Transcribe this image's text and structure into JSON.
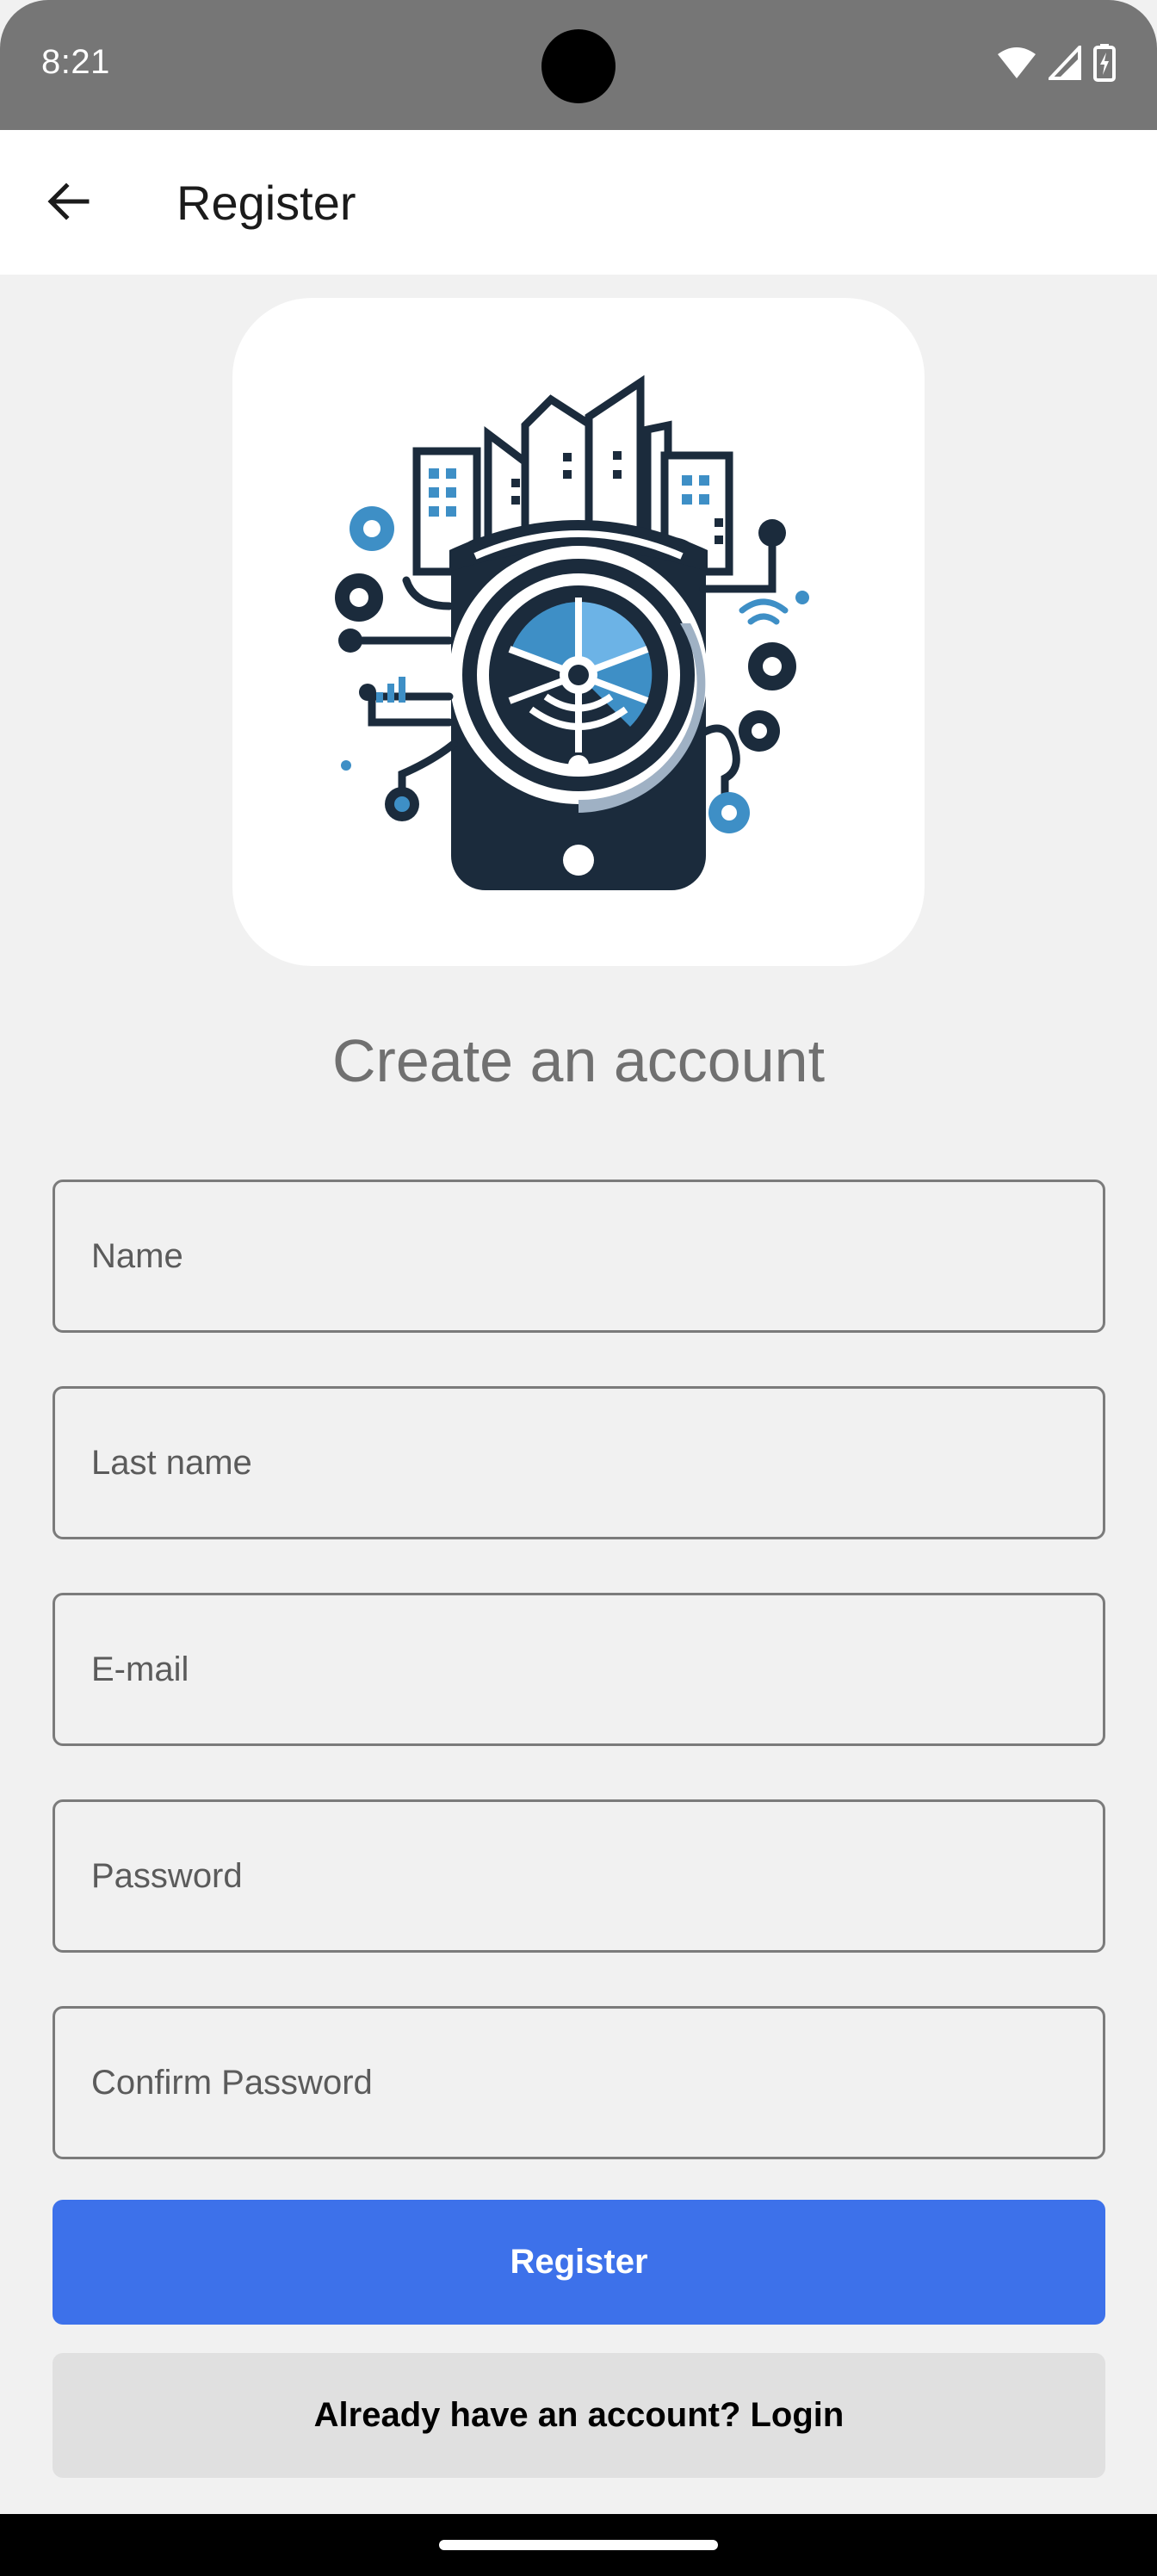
{
  "status_bar": {
    "time": "8:21",
    "icons": [
      "wifi-icon",
      "signal-icon",
      "battery-charging-icon"
    ]
  },
  "app_bar": {
    "title": "Register",
    "back_icon": "arrow-back-icon"
  },
  "logo": {
    "description_icon": "smart-city-safe-logo"
  },
  "main": {
    "heading": "Create an account",
    "fields": {
      "name_placeholder": "Name",
      "last_name_placeholder": "Last name",
      "email_placeholder": "E-mail",
      "password_placeholder": "Password",
      "confirm_password_placeholder": "Confirm Password"
    },
    "register_label": "Register",
    "login_label": "Already have an account? Login"
  },
  "colors": {
    "primary": "#3d71ea",
    "background": "#f1f1f1",
    "status_bar": "#767676",
    "logo_dark": "#1b2b3c",
    "logo_blue": "#3e8fc6"
  }
}
